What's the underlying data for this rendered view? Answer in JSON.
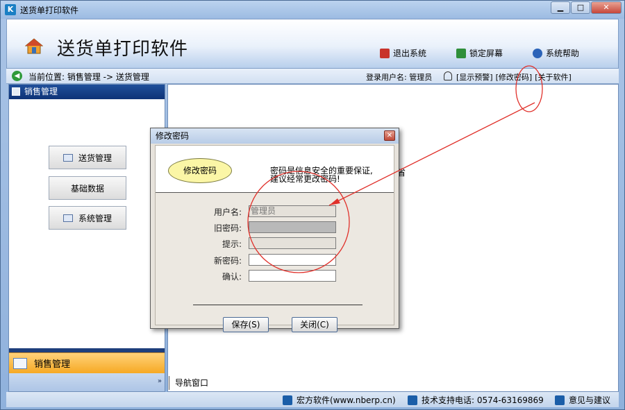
{
  "window": {
    "title": "送货单打印软件",
    "min_label": "▁",
    "max_label": "□",
    "close_label": "✕"
  },
  "header": {
    "app_title": "送货单打印软件",
    "exit_label": "退出系统",
    "lock_label": "锁定屏幕",
    "help_label": "系统帮助"
  },
  "navbar": {
    "location": "当前位置: 销售管理 -> 送货管理",
    "user": "登录用户名: 管理员",
    "links": [
      "[显示预警]",
      "[修改密码]",
      "[关于软件]"
    ]
  },
  "sidebar": {
    "header": "销售管理",
    "buttons": [
      "送货管理",
      "基础数据",
      "系统管理"
    ],
    "bottom_label": "销售管理",
    "footer_chevron": "»"
  },
  "workarea": {
    "tab_label": "导航窗口",
    "partial_text": "省"
  },
  "statusbar": {
    "company": "宏方软件(www.nberp.cn)",
    "phone": "技术支持电话: 0574-63169869",
    "feedback": "意见与建议"
  },
  "dialog": {
    "title": "修改密码",
    "badge": "修改密码",
    "message_line1": "密码是信息安全的重要保证,",
    "message_line2": "建议经常更改密码!",
    "username_label": "用户名:",
    "username_value": "管理员",
    "old_password_label": "旧密码:",
    "hint_label": "提示:",
    "new_password_label": "新密码:",
    "confirm_label": "确认:",
    "save_label": "保存(S)",
    "close_label": "关闭(C)"
  },
  "colors": {
    "accent_blue": "#1f4f9a",
    "sidebar_bottom": "#f6a924",
    "annotation_red": "#e0302a"
  }
}
